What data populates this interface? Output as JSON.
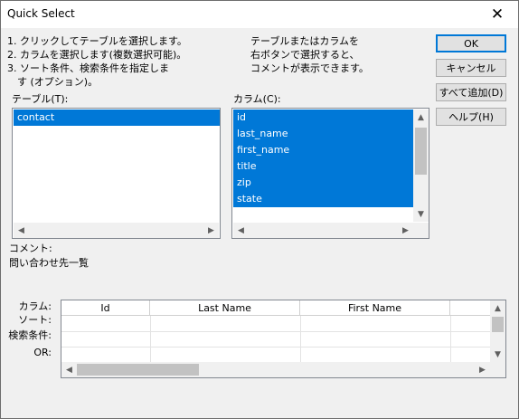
{
  "dialog": {
    "title": "Quick Select"
  },
  "instructions": {
    "steps": [
      "1. クリックしてテーブルを選択します。",
      "2. カラムを選択します(複数選択可能)。",
      "3. ソート条件、検索条件を指定しま",
      "　す (オプション)。"
    ],
    "hint": [
      "テーブルまたはカラムを",
      "右ボタンで選択すると、",
      "コメントが表示できます。"
    ]
  },
  "buttons": {
    "ok": "OK",
    "cancel": "キャンセル",
    "add_all": "すべて追加(D)",
    "help": "ヘルプ(H)"
  },
  "tables": {
    "label": "テーブル(T):",
    "items": [
      "contact"
    ],
    "selected": "contact"
  },
  "columns": {
    "label": "カラム(C):",
    "items": [
      "id",
      "last_name",
      "first_name",
      "title",
      "zip",
      "state"
    ],
    "all_selected": true
  },
  "comment": {
    "label": "コメント:",
    "value": "問い合わせ先一覧"
  },
  "grid": {
    "row_labels": [
      "カラム:",
      "ソート:",
      "検索条件:",
      "OR:"
    ],
    "headers": [
      "Id",
      "Last Name",
      "First Name"
    ]
  },
  "colors": {
    "selection": "#0078d7",
    "default_button_border": "#0078d7"
  },
  "icons": [
    "close-icon",
    "scroll-up-icon",
    "scroll-down-icon",
    "scroll-left-icon",
    "scroll-right-icon"
  ]
}
